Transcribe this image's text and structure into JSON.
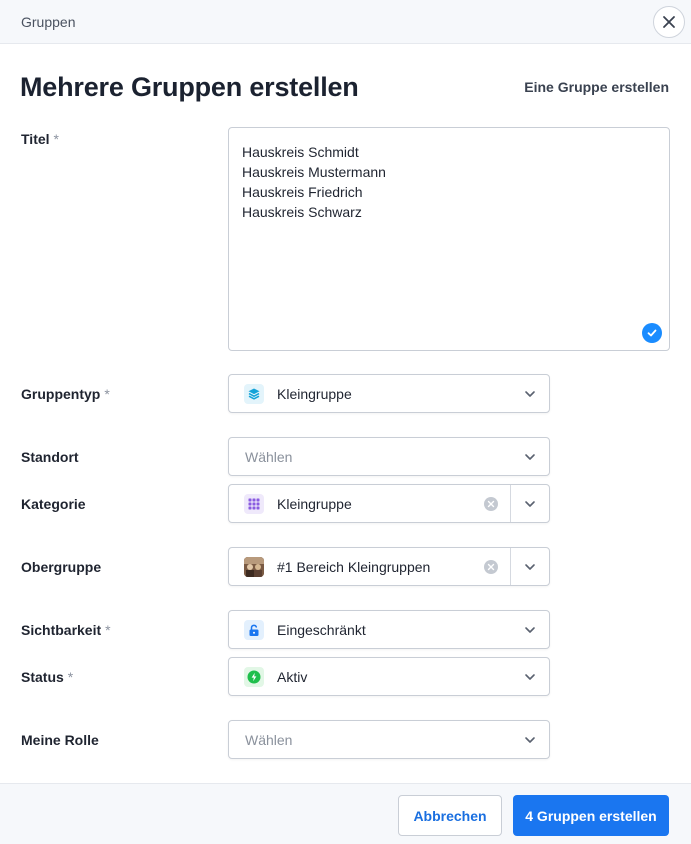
{
  "header": {
    "breadcrumb": "Gruppen"
  },
  "title": "Mehrere Gruppen erstellen",
  "switch_link": "Eine Gruppe erstellen",
  "required_marker": "*",
  "fields": {
    "titel": {
      "label": "Titel",
      "lines": [
        "Hauskreis Schmidt",
        "Hauskreis Mustermann",
        "Hauskreis Friedrich",
        "Hauskreis Schwarz"
      ]
    },
    "gruppentyp": {
      "label": "Gruppentyp",
      "value": "Kleingruppe",
      "icon": "layers-icon",
      "icon_color": "#e3f4fb"
    },
    "standort": {
      "label": "Standort",
      "placeholder": "Wählen"
    },
    "kategorie": {
      "label": "Kategorie",
      "value": "Kleingruppe",
      "icon": "grid-icon",
      "icon_color": "#efe9fb"
    },
    "obergruppe": {
      "label": "Obergruppe",
      "value": "#1 Bereich Kleingruppen",
      "icon": "group-avatar"
    },
    "sichtbarkeit": {
      "label": "Sichtbarkeit",
      "value": "Eingeschränkt",
      "icon": "unlock-icon",
      "icon_color": "#e3f0fd"
    },
    "status": {
      "label": "Status",
      "value": "Aktiv",
      "icon": "bolt-icon",
      "icon_color": "#e2f7e6"
    },
    "meine_rolle": {
      "label": "Meine Rolle",
      "placeholder": "Wählen"
    }
  },
  "buttons": {
    "cancel": "Abbrechen",
    "submit": "4 Gruppen erstellen"
  },
  "colors": {
    "primary": "#1a76f0",
    "check": "#1a8cff"
  }
}
